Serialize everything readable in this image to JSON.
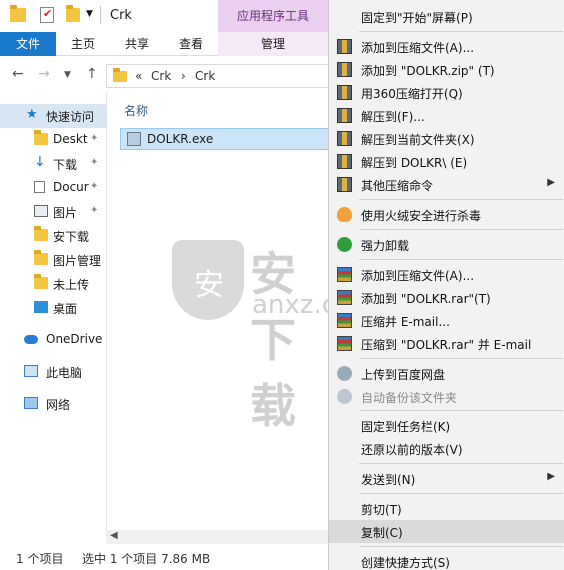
{
  "explorer": {
    "title": "Crk",
    "contextual_group": "应用程序工具",
    "tabs": [
      "文件",
      "主页",
      "共享",
      "查看",
      "管理"
    ],
    "address": {
      "prefix": "«",
      "crumbs": [
        "Crk",
        "Crk"
      ],
      "sep": "›"
    },
    "nav": [
      {
        "label": "快速访问",
        "pinned": false
      },
      {
        "label": "Deskt",
        "pinned": true
      },
      {
        "label": "下载",
        "pinned": true
      },
      {
        "label": "Docur",
        "pinned": true
      },
      {
        "label": "图片",
        "pinned": true
      },
      {
        "label": "安下载",
        "pinned": false
      },
      {
        "label": "图片管理",
        "pinned": false
      },
      {
        "label": "未上传",
        "pinned": false
      },
      {
        "label": "桌面",
        "pinned": false
      },
      {
        "label": "OneDrive",
        "pinned": false
      },
      {
        "label": "此电脑",
        "pinned": false
      },
      {
        "label": "网络",
        "pinned": false
      }
    ],
    "column_header": "名称",
    "file_name": "DOLKR.exe",
    "status_count": "1 个项目",
    "status_selected": "选中 1 个项目  7.86 MB"
  },
  "watermark": {
    "cn": "安下载",
    "domain": "anxz.com"
  },
  "context_menu": {
    "items": [
      {
        "label": "固定到\"开始\"屏幕(P)",
        "icon": "none-icon"
      },
      {
        "label": "添加到压缩文件(A)...",
        "icon": "zip-icon"
      },
      {
        "label": "添加到 \"DOLKR.zip\" (T)",
        "icon": "zip-icon"
      },
      {
        "label": "用360压缩打开(Q)",
        "icon": "zip-icon"
      },
      {
        "label": "解压到(F)...",
        "icon": "zip-icon"
      },
      {
        "label": "解压到当前文件夹(X)",
        "icon": "zip-icon"
      },
      {
        "label": "解压到 DOLKR\\ (E)",
        "icon": "zip-icon"
      },
      {
        "label": "其他压缩命令",
        "icon": "zip-icon",
        "submenu": true
      },
      {
        "label": "使用火绒安全进行杀毒",
        "icon": "antivirus-icon"
      },
      {
        "label": "强力卸载",
        "icon": "uninstall-icon"
      },
      {
        "label": "添加到压缩文件(A)...",
        "icon": "rar-icon"
      },
      {
        "label": "添加到 \"DOLKR.rar\"(T)",
        "icon": "rar-icon"
      },
      {
        "label": "压缩并 E-mail...",
        "icon": "rar-icon"
      },
      {
        "label": "压缩到 \"DOLKR.rar\" 并 E-mail",
        "icon": "rar-icon"
      },
      {
        "label": "上传到百度网盘",
        "icon": "cloud-icon"
      },
      {
        "label": "自动备份该文件夹",
        "icon": "cloud-icon",
        "disabled": true
      },
      {
        "label": "固定到任务栏(K)",
        "icon": "none-icon"
      },
      {
        "label": "还原以前的版本(V)",
        "icon": "none-icon"
      },
      {
        "label": "发送到(N)",
        "icon": "none-icon",
        "submenu": true
      },
      {
        "label": "剪切(T)",
        "icon": "none-icon"
      },
      {
        "label": "复制(C)",
        "icon": "none-icon",
        "highlighted": true
      },
      {
        "label": "创建快捷方式(S)",
        "icon": "none-icon"
      }
    ]
  }
}
